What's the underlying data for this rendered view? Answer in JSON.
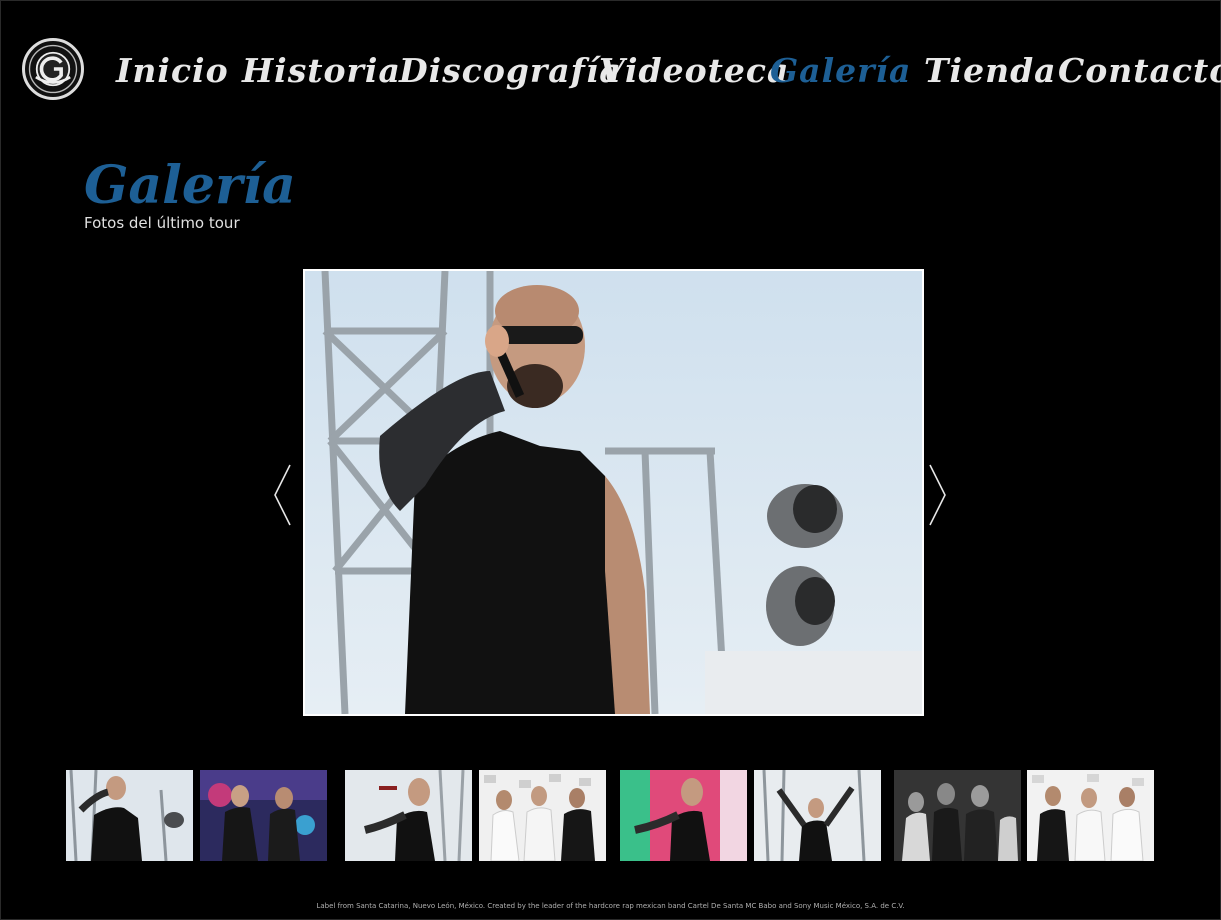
{
  "nav": {
    "items": [
      {
        "label": "Inicio",
        "active": false
      },
      {
        "label": "Historia",
        "active": false
      },
      {
        "label": "Discografía",
        "active": false
      },
      {
        "label": "Videoteca",
        "active": false
      },
      {
        "label": "Galería",
        "active": true
      },
      {
        "label": "Tienda",
        "active": false
      },
      {
        "label": "Contactos",
        "active": false
      }
    ]
  },
  "page": {
    "title": "Galería",
    "subtitle": "Fotos del último tour"
  },
  "gallery": {
    "prev_icon": "chevron-left-icon",
    "next_icon": "chevron-right-icon",
    "thumbnails_count": 8
  },
  "colors": {
    "background": "#000000",
    "accent": "#1d5f95",
    "nav_text": "#e8e8e8"
  },
  "footer": {
    "text": "Label from Santa Catarina, Nuevo León, México. Created by the leader of the hardcore rap mexican band Cartel De Santa MC Babo and Sony Music México, S.A. de C.V."
  }
}
